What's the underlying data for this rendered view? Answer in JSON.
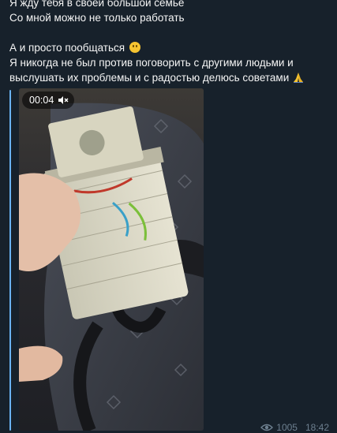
{
  "message": {
    "lines": [
      "Я жду тебя в своей большой семье",
      "Со мной можно не только работать",
      "А и просто пообщаться",
      "Я никогда не был против поговорить с другими людьми и",
      "выслушать их проблемы и с радостью делюсь советами"
    ],
    "emoji": [
      "smile-emoji",
      "pray-emoji"
    ]
  },
  "video": {
    "duration": "00:04",
    "muted_icon": "mute-icon"
  },
  "footer": {
    "views": "1005",
    "time": "18:42"
  },
  "colors": {
    "background": "#17212b",
    "accent": "#6ab3f3",
    "meta": "#6d7f8f"
  }
}
